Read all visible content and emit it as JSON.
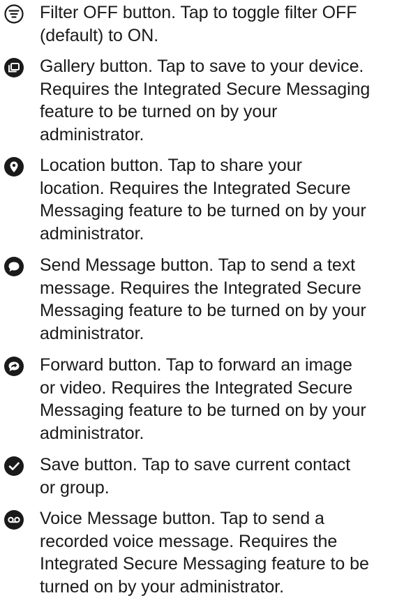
{
  "colors": {
    "text": "#1a1a1a",
    "icon": "#1a1a1a"
  },
  "items": [
    {
      "icon": "filter-off-icon",
      "text": "Filter OFF button. Tap to toggle filter OFF\n(default) to ON."
    },
    {
      "icon": "gallery-icon",
      "text": "Gallery button. Tap to save to your device.\nRequires the Integrated Secure Messaging\nfeature to be turned on by your\nadministrator."
    },
    {
      "icon": "location-pin-icon",
      "text": "Location button. Tap to share your\nlocation. Requires the Integrated Secure\nMessaging feature to be turned on by your\nadministrator."
    },
    {
      "icon": "chat-bubble-icon",
      "text": "Send Message button. Tap to send a text\nmessage. Requires the Integrated Secure\nMessaging feature to be turned on by your\nadministrator."
    },
    {
      "icon": "forward-icon",
      "text": "Forward button. Tap to forward an image\nor video. Requires the Integrated Secure\nMessaging feature to be turned on by your\nadministrator."
    },
    {
      "icon": "checkmark-icon",
      "text": "Save button. Tap to save current contact\nor group."
    },
    {
      "icon": "voicemail-icon",
      "text": "Voice Message button. Tap to send a\nrecorded voice message. Requires the\nIntegrated Secure Messaging feature to be\nturned on by your administrator."
    }
  ]
}
